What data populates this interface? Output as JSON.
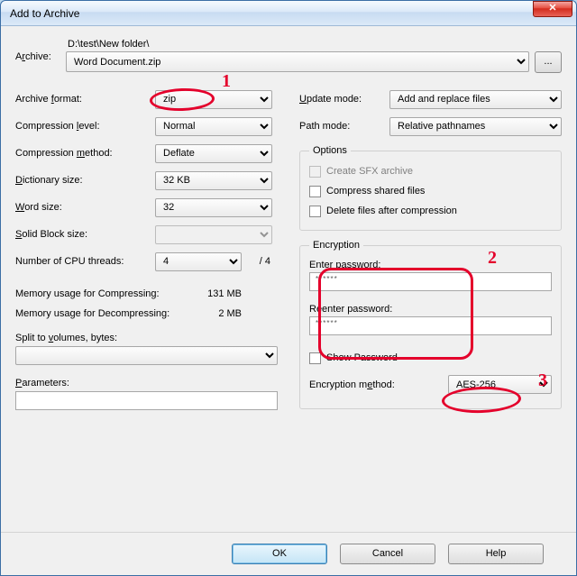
{
  "window": {
    "title": "Add to Archive",
    "close_glyph": "✕"
  },
  "archive": {
    "label_pre": "A",
    "label_und": "r",
    "label_post": "chive:",
    "path": "D:\\test\\New folder\\",
    "filename": "Word Document.zip",
    "browse": "..."
  },
  "left": {
    "format": {
      "pre": "Archive ",
      "und": "f",
      "post": "ormat:",
      "value": "zip"
    },
    "level": {
      "pre": "Compression ",
      "und": "l",
      "post": "evel:",
      "value": "Normal"
    },
    "method": {
      "pre": "Compression ",
      "und": "m",
      "post": "ethod:",
      "value": "Deflate"
    },
    "dict": {
      "und": "D",
      "post": "ictionary size:",
      "value": "32 KB"
    },
    "word": {
      "und": "W",
      "post": "ord size:",
      "value": "32"
    },
    "solid": {
      "und": "S",
      "post": "olid Block size:",
      "value": ""
    },
    "threads": {
      "label": "Number of CPU threads:",
      "value": "4",
      "trail": "/ 4"
    },
    "mem_c": {
      "label": "Memory usage for Compressing:",
      "value": "131 MB"
    },
    "mem_d": {
      "label": "Memory usage for Decompressing:",
      "value": "2 MB"
    },
    "split": {
      "pre": "Split to ",
      "und": "v",
      "post": "olumes, bytes:"
    },
    "params": {
      "und": "P",
      "post": "arameters:"
    }
  },
  "right": {
    "update": {
      "und": "U",
      "post": "pdate mode:",
      "value": "Add and replace files"
    },
    "pathmode": {
      "label": "Path mode:",
      "value": "Relative pathnames"
    },
    "options": {
      "legend": "Options",
      "sfx": "Create SFX archive",
      "shared": "Compress shared files",
      "del": "Delete files after compression"
    },
    "enc": {
      "legend": "Encryption",
      "enter": "Enter password:",
      "reenter": "Reenter password:",
      "pw_mask": "******",
      "show": "Show Password",
      "meth_pre": "Encryption m",
      "meth_und": "e",
      "meth_post": "thod:",
      "method": "AES-256"
    }
  },
  "buttons": {
    "ok": "OK",
    "cancel": "Cancel",
    "help": "Help"
  },
  "annotations": {
    "n1": "1",
    "n2": "2",
    "n3": "3"
  }
}
